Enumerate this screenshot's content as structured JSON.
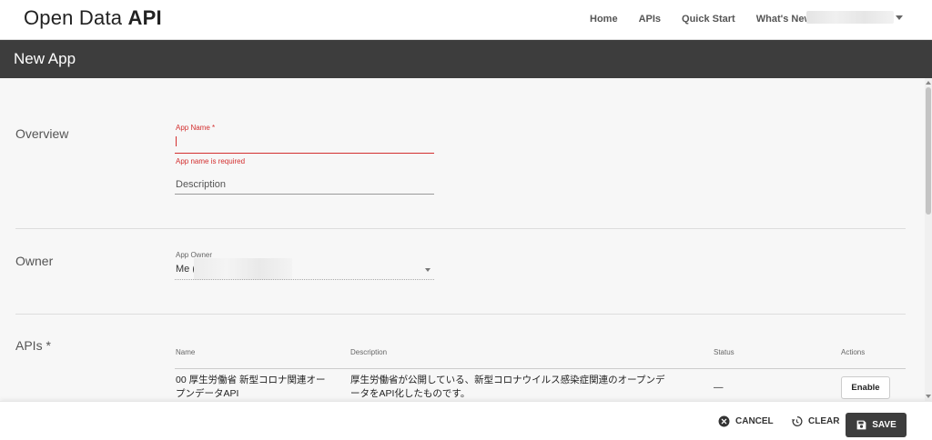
{
  "nav": {
    "brand_light": "Open Data ",
    "brand_bold": "API",
    "links": [
      "Home",
      "APIs",
      "Quick Start",
      "What's New"
    ]
  },
  "page": {
    "title": "New App"
  },
  "overview": {
    "section_label": "Overview",
    "app_name_label": "App Name *",
    "app_name_value": "",
    "app_name_error": "App name is required",
    "description_placeholder": "Description"
  },
  "owner": {
    "section_label": "Owner",
    "label": "App Owner",
    "value": "Me ("
  },
  "apis": {
    "section_label": "APIs *",
    "columns": [
      "Name",
      "Description",
      "Status",
      "Actions"
    ],
    "rows": [
      {
        "name_line1": "00 厚生労働省 新型コロナ関連オー",
        "name_line2": "プンデータAPI",
        "desc_line1": "厚生労働省が公開している、新型コロナウイルス感染症関連のオープンデ",
        "desc_line2": "ータをAPI化したものです。",
        "status": "—",
        "action": "Enable"
      }
    ]
  },
  "footer": {
    "cancel": "CANCEL",
    "clear": "CLEAR",
    "save": "SAVE"
  },
  "colors": {
    "error": "#d32f2f",
    "dark_bar": "#3d3d3d"
  }
}
